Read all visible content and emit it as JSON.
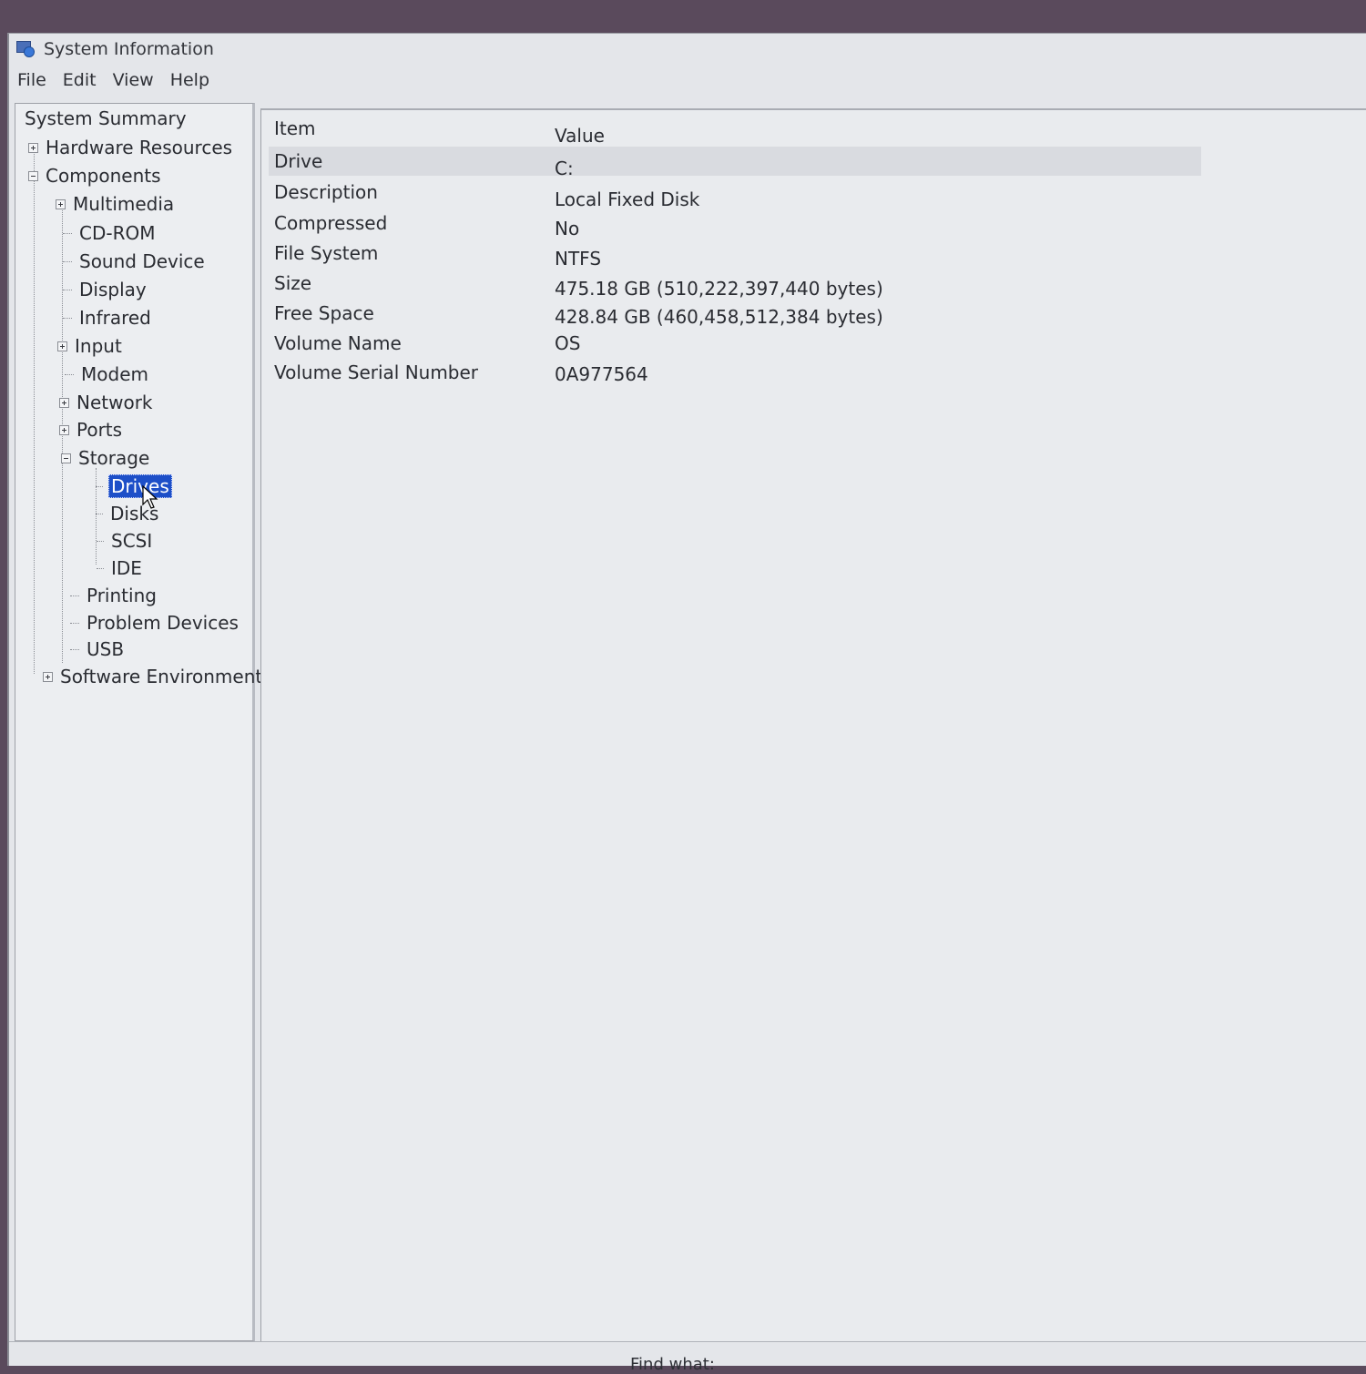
{
  "window": {
    "title": "System Information"
  },
  "menu": [
    "File",
    "Edit",
    "View",
    "Help"
  ],
  "tree": [
    {
      "label": "System Summary",
      "type": "root"
    },
    {
      "label": "Hardware Resources",
      "type": "collapsed"
    },
    {
      "label": "Components",
      "type": "expanded"
    },
    {
      "label": "Multimedia",
      "type": "collapsed"
    },
    {
      "label": "CD-ROM",
      "type": "leaf"
    },
    {
      "label": "Sound Device",
      "type": "leaf"
    },
    {
      "label": "Display",
      "type": "leaf"
    },
    {
      "label": "Infrared",
      "type": "leaf"
    },
    {
      "label": "Input",
      "type": "collapsed"
    },
    {
      "label": "Modem",
      "type": "leaf"
    },
    {
      "label": "Network",
      "type": "collapsed"
    },
    {
      "label": "Ports",
      "type": "collapsed"
    },
    {
      "label": "Storage",
      "type": "expanded"
    },
    {
      "label": "Drives",
      "type": "leaf",
      "selected": true
    },
    {
      "label": "Disks",
      "type": "leaf"
    },
    {
      "label": "SCSI",
      "type": "leaf"
    },
    {
      "label": "IDE",
      "type": "leaf"
    },
    {
      "label": "Printing",
      "type": "leaf"
    },
    {
      "label": "Problem Devices",
      "type": "leaf"
    },
    {
      "label": "USB",
      "type": "leaf"
    },
    {
      "label": "Software Environment",
      "type": "collapsed"
    }
  ],
  "details": {
    "columns": {
      "item": "Item",
      "value": "Value"
    },
    "rows": [
      {
        "item": "Drive",
        "value": "C:"
      },
      {
        "item": "Description",
        "value": "Local Fixed Disk"
      },
      {
        "item": "Compressed",
        "value": "No"
      },
      {
        "item": "File System",
        "value": "NTFS"
      },
      {
        "item": "Size",
        "value": "475.18 GB (510,222,397,440 bytes)"
      },
      {
        "item": "Free Space",
        "value": "428.84 GB (460,458,512,384 bytes)"
      },
      {
        "item": "Volume Name",
        "value": "OS"
      },
      {
        "item": "Volume Serial Number",
        "value": "0A977564"
      }
    ]
  },
  "status": {
    "find_label": "Find what:"
  },
  "colors": {
    "selection": "#1d4fc8",
    "window_bg": "#e4e6ea"
  },
  "icons": {
    "app": "system-information-icon",
    "expand": "tree-expand-icon",
    "collapse": "tree-collapse-icon"
  }
}
